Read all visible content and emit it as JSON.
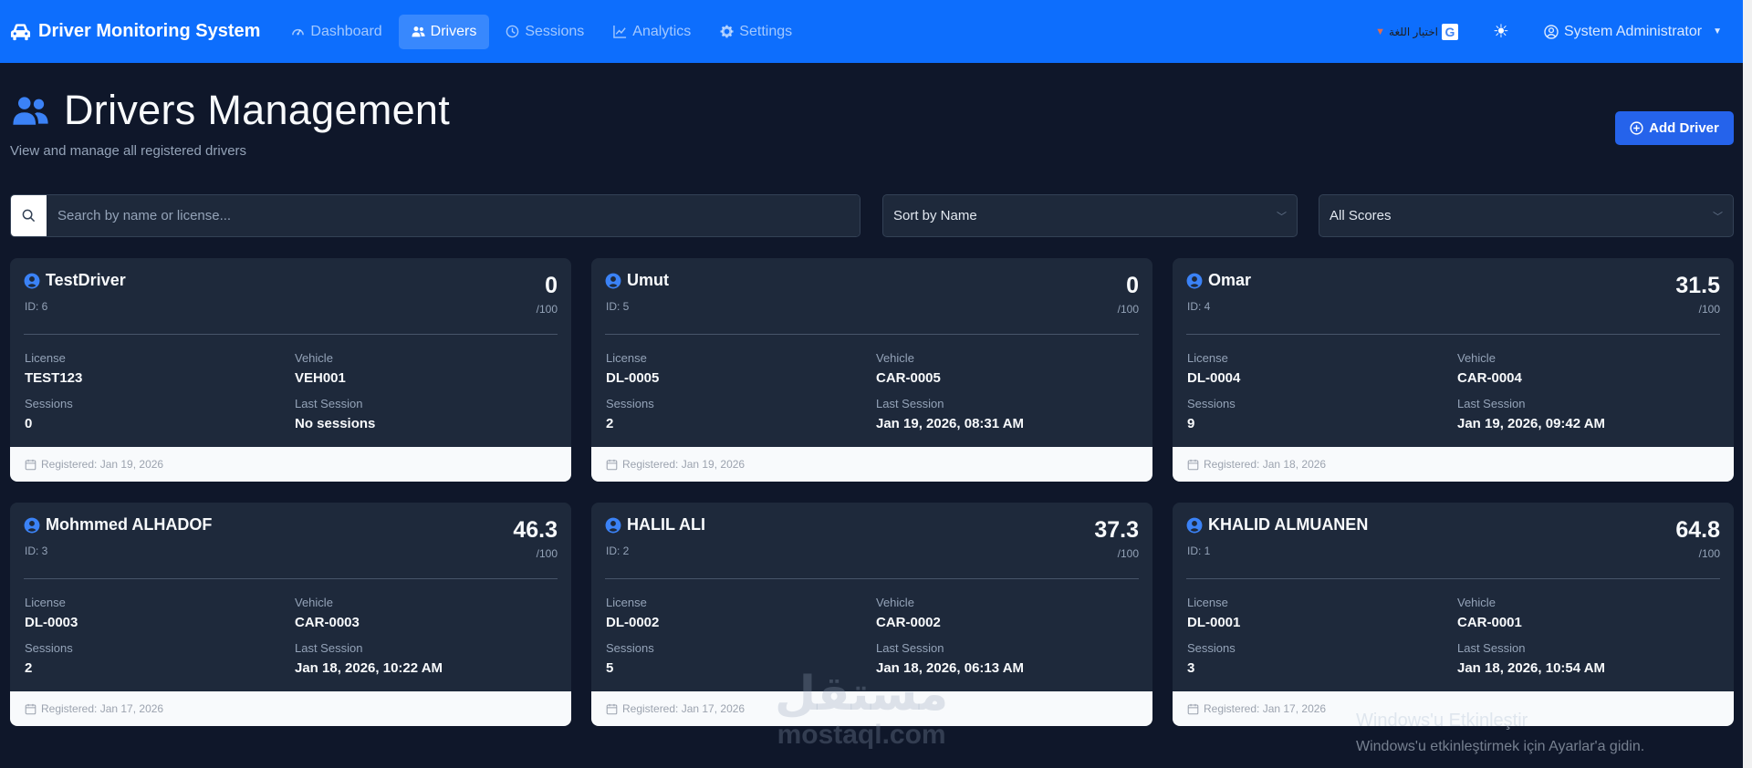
{
  "navbar": {
    "brand": "Driver Monitoring System",
    "links": [
      {
        "label": "Dashboard",
        "icon": "gauge-icon",
        "active": false
      },
      {
        "label": "Drivers",
        "icon": "users-icon",
        "active": true
      },
      {
        "label": "Sessions",
        "icon": "clock-icon",
        "active": false
      },
      {
        "label": "Analytics",
        "icon": "chart-line-icon",
        "active": false
      },
      {
        "label": "Settings",
        "icon": "gear-icon",
        "active": false
      }
    ],
    "language_label": "اختيار اللغة",
    "language_icon": "google-translate-icon",
    "theme_icon": "sun-icon",
    "user_name": "System Administrator"
  },
  "header": {
    "title": "Drivers Management",
    "subtitle": "View and manage all registered drivers",
    "add_button": "Add Driver"
  },
  "filters": {
    "search_placeholder": "Search by name or license...",
    "sort_value": "Sort by Name",
    "score_value": "All Scores"
  },
  "labels": {
    "license": "License",
    "vehicle": "Vehicle",
    "sessions": "Sessions",
    "last_session": "Last Session",
    "score_max": "/100"
  },
  "drivers": [
    {
      "name": "TestDriver",
      "id": "ID: 6",
      "score": "0",
      "license": "TEST123",
      "vehicle": "VEH001",
      "sessions": "0",
      "last_session": "No sessions",
      "registered": "Registered: Jan 19, 2026"
    },
    {
      "name": "Umut",
      "id": "ID: 5",
      "score": "0",
      "license": "DL-0005",
      "vehicle": "CAR-0005",
      "sessions": "2",
      "last_session": "Jan 19, 2026, 08:31 AM",
      "registered": "Registered: Jan 19, 2026"
    },
    {
      "name": "Omar",
      "id": "ID: 4",
      "score": "31.5",
      "license": "DL-0004",
      "vehicle": "CAR-0004",
      "sessions": "9",
      "last_session": "Jan 19, 2026, 09:42 AM",
      "registered": "Registered: Jan 18, 2026"
    },
    {
      "name": "Mohmmed ALHADOF",
      "id": "ID: 3",
      "score": "46.3",
      "license": "DL-0003",
      "vehicle": "CAR-0003",
      "sessions": "2",
      "last_session": "Jan 18, 2026, 10:22 AM",
      "registered": "Registered: Jan 17, 2026"
    },
    {
      "name": "HALIL ALI",
      "id": "ID: 2",
      "score": "37.3",
      "license": "DL-0002",
      "vehicle": "CAR-0002",
      "sessions": "5",
      "last_session": "Jan 18, 2026, 06:13 AM",
      "registered": "Registered: Jan 17, 2026"
    },
    {
      "name": "KHALID ALMUANEN",
      "id": "ID: 1",
      "score": "64.8",
      "license": "DL-0001",
      "vehicle": "CAR-0001",
      "sessions": "3",
      "last_session": "Jan 18, 2026, 10:54 AM",
      "registered": "Registered: Jan 17, 2026"
    }
  ],
  "watermark": {
    "logo": "مستقل",
    "site": "mostaql.com"
  },
  "activation": {
    "title": "Windows'u Etkinleştir",
    "subtitle": "Windows'u etkinleştirmek için Ayarlar'a gidin."
  },
  "colors": {
    "primary": "#0d6efd",
    "background": "#0f172a",
    "card": "#1e293b"
  }
}
